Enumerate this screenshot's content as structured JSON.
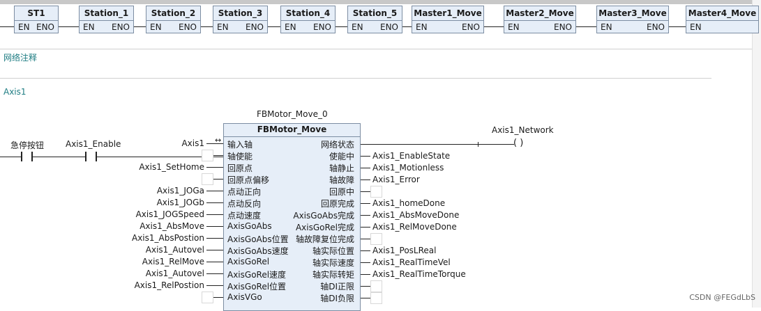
{
  "top_blocks": [
    {
      "title": "ST1",
      "en": "EN",
      "eno": "ENO"
    },
    {
      "title": "Station_1",
      "en": "EN",
      "eno": "ENO"
    },
    {
      "title": "Station_2",
      "en": "EN",
      "eno": "ENO"
    },
    {
      "title": "Station_3",
      "en": "EN",
      "eno": "ENO"
    },
    {
      "title": "Station_4",
      "en": "EN",
      "eno": "ENO"
    },
    {
      "title": "Station_5",
      "en": "EN",
      "eno": "ENO"
    },
    {
      "title": "Master1_Move",
      "en": "EN",
      "eno": "ENO"
    },
    {
      "title": "Master2_Move",
      "en": "EN",
      "eno": "ENO"
    },
    {
      "title": "Master3_Move",
      "en": "EN",
      "eno": "ENO"
    },
    {
      "title": "Master4_Move",
      "en": "EN",
      "eno": ""
    }
  ],
  "network_comment": "网络注释",
  "network_title": "Axis1",
  "contacts": {
    "estop_label": "急停按钮",
    "enable_label": "Axis1_Enable"
  },
  "fb": {
    "instance": "FBMotor_Move_0",
    "type": "FBMotor_Move",
    "input_pins": [
      "输入轴",
      "轴使能",
      "回原点",
      "回原点偏移",
      "点动正向",
      "点动反向",
      "点动速度",
      "AxisGoAbs",
      "AxisGoAbs位置",
      "AxisGoAbs速度",
      "AxisGoRel",
      "AxisGoRel速度",
      "AxisGoRel位置",
      "AxisVGo"
    ],
    "output_pins": [
      "网络状态",
      "使能中",
      "轴静止",
      "轴故障",
      "回原中",
      "回原完成",
      "AxisGoAbs完成",
      "AxisGoRel完成",
      "轴故障复位完成",
      "轴实际位置",
      "轴实际速度",
      "轴实际转矩",
      "轴DI正限",
      "轴DI负限"
    ],
    "input_vars": [
      "Axis1",
      "",
      "Axis1_SetHome",
      "",
      "Axis1_JOGa",
      "Axis1_JOGb",
      "Axis1_JOGSpeed",
      "Axis1_AbsMove",
      "Axis1_AbsPostion",
      "Axis1_Autovel",
      "Axis1_RelMove",
      "Axis1_Autovel",
      "Axis1_RelPostion",
      ""
    ],
    "output_vars": [
      "",
      "Axis1_EnableState",
      "Axis1_Motionless",
      "Axis1_Error",
      "",
      "Axis1_homeDone",
      "Axis1_AbsMoveDone",
      "Axis1_RelMoveDone",
      "",
      "Axis1_PosLReal",
      "Axis1_RealTimeVel",
      "Axis1_RealTimeTorque",
      "",
      ""
    ]
  },
  "coil": {
    "label": "Axis1_Network",
    "symbol": "( )"
  },
  "inout_arrow": "↔",
  "watermark": "CSDN @FEGdLbS"
}
